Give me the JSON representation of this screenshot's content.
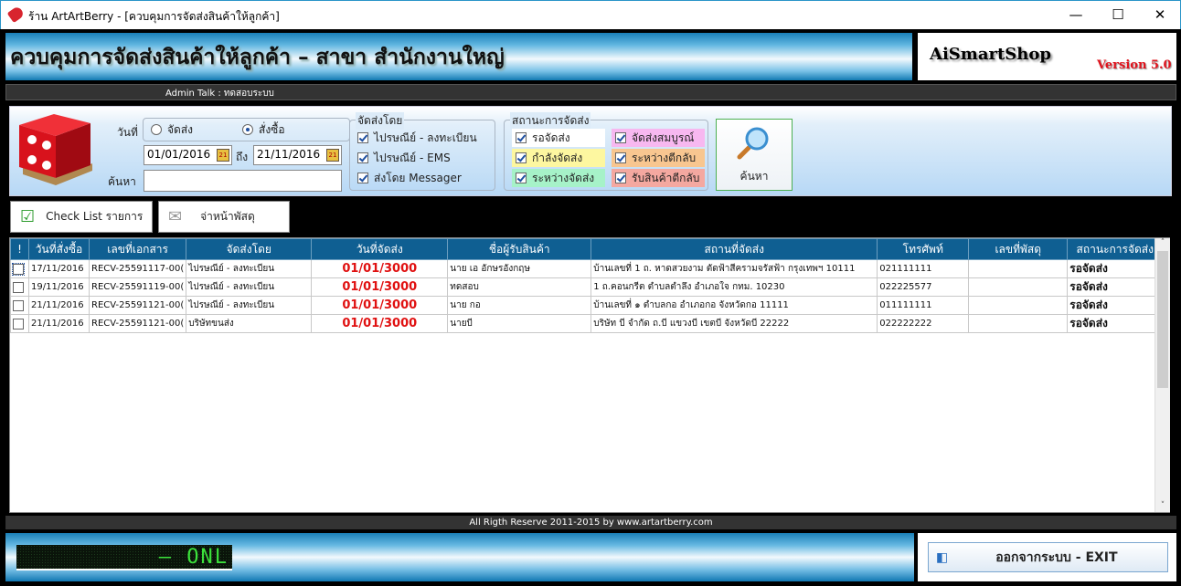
{
  "window": {
    "title": "ร้าน ArtArtBerry - [ควบคุมการจัดส่งสินค้าให้ลูกค้า]",
    "min": "—",
    "max": "☐",
    "close": "✕"
  },
  "header": {
    "title": "ควบคุมการจัดส่งสินค้าให้ลูกค้า – สาขา สำนักงานใหญ่",
    "brand": "AiSmartShop",
    "version": "Version 5.0"
  },
  "admin_talk": "Admin Talk : ทดสอบระบบ",
  "filter": {
    "date_label": "วันที่",
    "date_options": [
      {
        "label": "จัดส่ง",
        "selected": false
      },
      {
        "label": "สั่งซื้อ",
        "selected": true
      }
    ],
    "from": "01/01/2016",
    "to_label": "ถึง",
    "to": "21/11/2016",
    "search_label": "ค้นหา",
    "search_value": "",
    "cal_icon": "21",
    "ship_by_title": "จัดส่งโดย",
    "ship_by": [
      {
        "label": "ไปรษณีย์ - ลงทะเบียน",
        "checked": true
      },
      {
        "label": "ไปรษณีย์ - EMS",
        "checked": true
      },
      {
        "label": "ส่งโดย Messager",
        "checked": true
      }
    ],
    "status_title": "สถานะการจัดส่ง",
    "statuses": [
      {
        "label": "รอจัดส่ง",
        "checked": true,
        "color": "#ffffff"
      },
      {
        "label": "จัดส่งสมบูรณ์",
        "checked": true,
        "color": "#f7b8f0"
      },
      {
        "label": "กำลังจัดส่ง",
        "checked": true,
        "color": "#fdf7a0"
      },
      {
        "label": "ระหว่างตีกลับ",
        "checked": true,
        "color": "#f8c690"
      },
      {
        "label": "ระหว่างจัดส่ง",
        "checked": true,
        "color": "#a6f2c8"
      },
      {
        "label": "รับสินค้าตีกลับ",
        "checked": true,
        "color": "#f4a8a0"
      }
    ],
    "search_button": "ค้นหา"
  },
  "toolbar": {
    "checklist": "Check List รายการ",
    "label_print": "จ่าหน้าพัสดุ"
  },
  "grid": {
    "columns": [
      "!",
      "วันที่สั่งซื้อ",
      "เลขที่เอกสาร",
      "จัดส่งโดย",
      "วันที่จัดส่ง",
      "ชื่อผู้รับสินค้า",
      "สถานที่จัดส่ง",
      "โทรศัพท์",
      "เลขที่พัสดุ",
      "สถานะการจัดส่ง"
    ],
    "rows": [
      [
        "17/11/2016",
        "RECV-25591117-00(",
        "ไปรษณีย์ - ลงทะเบียน",
        "01/01/3000",
        "นาย เอ อักษรอังกฤษ",
        "บ้านเลขที่ 1 ถ. หาดสวยงาม ตัดฟ้าสีครามจรัสฟ้า กรุงเทพฯ 10111",
        "021111111",
        "",
        "รอจัดส่ง"
      ],
      [
        "19/11/2016",
        "RECV-25591119-00(",
        "ไปรษณีย์ - ลงทะเบียน",
        "01/01/3000",
        "ทดสอบ",
        "1 ถ.คอนกรีต ตำบลตำลึง อำเภอใจ กทม. 10230",
        "022225577",
        "",
        "รอจัดส่ง"
      ],
      [
        "21/11/2016",
        "RECV-25591121-00(",
        "ไปรษณีย์ - ลงทะเบียน",
        "01/01/3000",
        "นาย กอ",
        "บ้านเลขที่ ๑ ตำบลกอ อำเภอกอ จังหวัดกอ 11111",
        "011111111",
        "",
        "รอจัดส่ง"
      ],
      [
        "21/11/2016",
        "RECV-25591121-00(",
        "บริษัทขนส่ง",
        "01/01/3000",
        "นายบี",
        "บริษัท บี จำกัด ถ.บี แขวงบี เขตบี จังหวัดบี 22222",
        "022222222",
        "",
        "รอจัดส่ง"
      ]
    ]
  },
  "footer": "All Rigth Reserve 2011-2015 by www.artartberry.com",
  "led": "— ONL",
  "exit_button": "ออกจากระบบ - EXIT"
}
